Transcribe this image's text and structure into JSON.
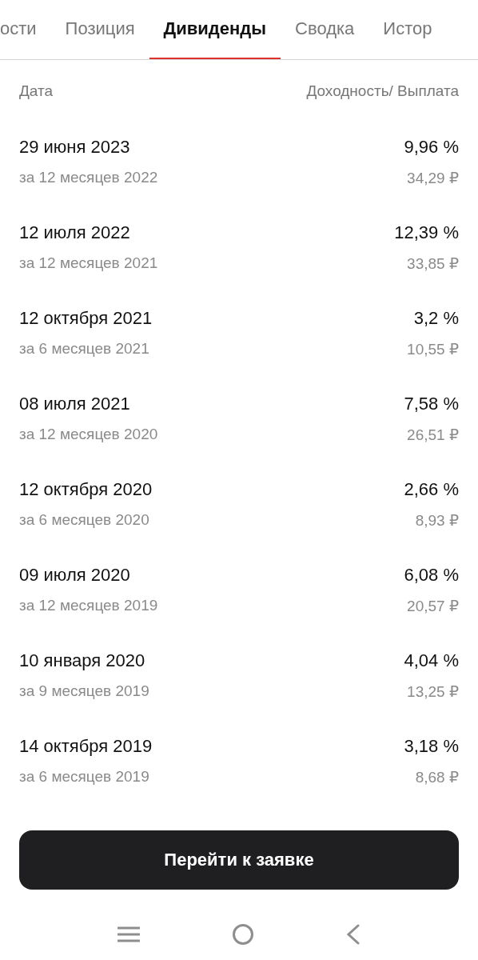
{
  "tabs": [
    {
      "label": "ости",
      "selected": false
    },
    {
      "label": "Позиция",
      "selected": false
    },
    {
      "label": "Дивиденды",
      "selected": true
    },
    {
      "label": "Сводка",
      "selected": false
    },
    {
      "label": "Истор",
      "selected": false
    }
  ],
  "table": {
    "columns": [
      "Дата",
      "Доходность/ Выплата"
    ],
    "rows": [
      {
        "date": "29 июня 2023",
        "period": "за 12 месяцев 2022",
        "yield": "9,96 %",
        "payout": "34,29 ₽"
      },
      {
        "date": "12 июля 2022",
        "period": "за 12 месяцев 2021",
        "yield": "12,39 %",
        "payout": "33,85 ₽"
      },
      {
        "date": "12 октября 2021",
        "period": "за 6 месяцев 2021",
        "yield": "3,2 %",
        "payout": "10,55 ₽"
      },
      {
        "date": "08 июля 2021",
        "period": "за 12 месяцев 2020",
        "yield": "7,58 %",
        "payout": "26,51 ₽"
      },
      {
        "date": "12 октября 2020",
        "period": "за 6 месяцев 2020",
        "yield": "2,66 %",
        "payout": "8,93 ₽"
      },
      {
        "date": "09 июля 2020",
        "period": "за 12 месяцев 2019",
        "yield": "6,08 %",
        "payout": "20,57 ₽"
      },
      {
        "date": "10 января 2020",
        "period": "за 9 месяцев 2019",
        "yield": "4,04 %",
        "payout": "13,25 ₽"
      },
      {
        "date": "14 октября 2019",
        "period": "за 6 месяцев 2019",
        "yield": "3,18 %",
        "payout": "8,68 ₽"
      }
    ]
  },
  "action_button": "Перейти к заявке"
}
